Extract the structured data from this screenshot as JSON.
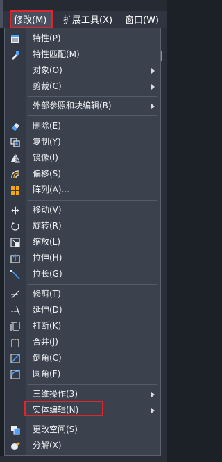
{
  "menubar": {
    "items": [
      {
        "label": "修改(M)"
      },
      {
        "label": "扩展工具(X)"
      },
      {
        "label": "窗口(W)"
      }
    ]
  },
  "menu": {
    "items": [
      {
        "label": "特性(P)",
        "icon": "properties-icon",
        "submenu": false
      },
      {
        "label": "特性匹配(M)",
        "icon": "match-properties-icon",
        "submenu": false
      },
      {
        "label": "对象(O)",
        "icon": "",
        "submenu": true
      },
      {
        "label": "剪裁(C)",
        "icon": "",
        "submenu": true
      },
      {
        "label": "外部参照和块编辑(B)",
        "icon": "",
        "submenu": true
      },
      {
        "label": "删除(E)",
        "icon": "eraser-icon",
        "submenu": false
      },
      {
        "label": "复制(Y)",
        "icon": "copy-icon",
        "submenu": false
      },
      {
        "label": "镜像(I)",
        "icon": "mirror-icon",
        "submenu": false
      },
      {
        "label": "偏移(S)",
        "icon": "offset-icon",
        "submenu": false
      },
      {
        "label": "阵列(A)...",
        "icon": "array-icon",
        "submenu": false
      },
      {
        "label": "移动(V)",
        "icon": "move-icon",
        "submenu": false
      },
      {
        "label": "旋转(R)",
        "icon": "rotate-icon",
        "submenu": false
      },
      {
        "label": "缩放(L)",
        "icon": "scale-icon",
        "submenu": false
      },
      {
        "label": "拉伸(H)",
        "icon": "stretch-icon",
        "submenu": false
      },
      {
        "label": "拉长(G)",
        "icon": "lengthen-icon",
        "submenu": false
      },
      {
        "label": "修剪(T)",
        "icon": "trim-icon",
        "submenu": false
      },
      {
        "label": "延伸(D)",
        "icon": "extend-icon",
        "submenu": false
      },
      {
        "label": "打断(K)",
        "icon": "break-icon",
        "submenu": false
      },
      {
        "label": "合并(J)",
        "icon": "join-icon",
        "submenu": false
      },
      {
        "label": "倒角(C)",
        "icon": "chamfer-icon",
        "submenu": false
      },
      {
        "label": "圆角(F)",
        "icon": "fillet-icon",
        "submenu": false
      },
      {
        "label": "三维操作(3)",
        "icon": "",
        "submenu": true
      },
      {
        "label": "实体编辑(N)",
        "icon": "",
        "submenu": true
      },
      {
        "label": "更改空间(S)",
        "icon": "change-space-icon",
        "submenu": false
      },
      {
        "label": "分解(X)",
        "icon": "explode-icon",
        "submenu": false
      }
    ]
  },
  "colors": {
    "menu_bg": "#3b414d",
    "highlight_border": "#e0262c",
    "accent_blue": "#4da3ff",
    "accent_orange": "#f3a712"
  }
}
